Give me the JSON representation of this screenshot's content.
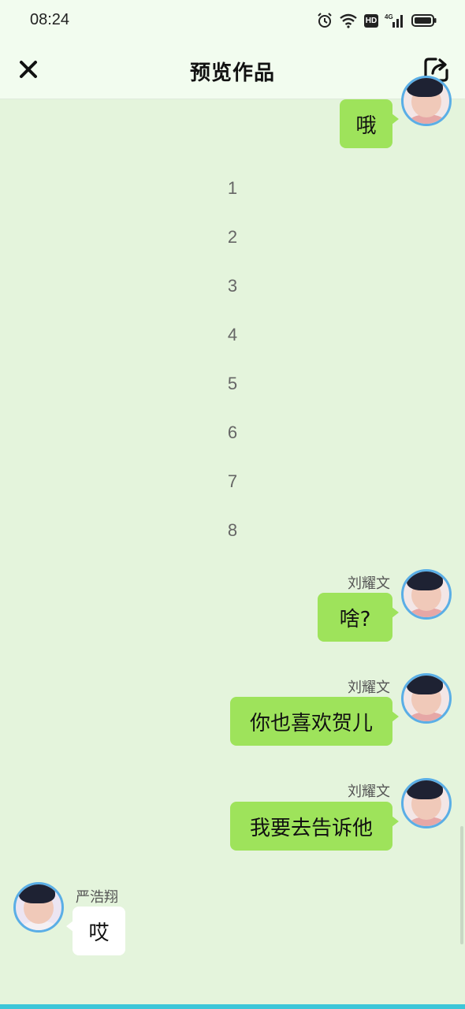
{
  "status_bar": {
    "time": "08:24",
    "network": "4G",
    "hd": "HD",
    "icons": [
      "alarm-icon",
      "wifi-icon",
      "hd-icon",
      "signal-icon",
      "battery-icon"
    ]
  },
  "header": {
    "title": "预览作品",
    "close_icon": "close-icon",
    "share_icon": "share-icon"
  },
  "colors": {
    "background": "#e4f4dc",
    "outgoing_bubble": "#9ee35b",
    "incoming_bubble": "#ffffff",
    "avatar_ring": "#5aaee6"
  },
  "messages": [
    {
      "sender": "",
      "text": "哦"
    },
    {
      "sender": "刘耀文",
      "text": "啥?"
    },
    {
      "sender": "刘耀文",
      "text": "你也喜欢贺儿"
    },
    {
      "sender": "刘耀文",
      "text": "我要去告诉他"
    },
    {
      "sender": "严浩翔",
      "text": "哎"
    }
  ],
  "numbered_lines": [
    "1",
    "2",
    "3",
    "4",
    "5",
    "6",
    "7",
    "8"
  ]
}
